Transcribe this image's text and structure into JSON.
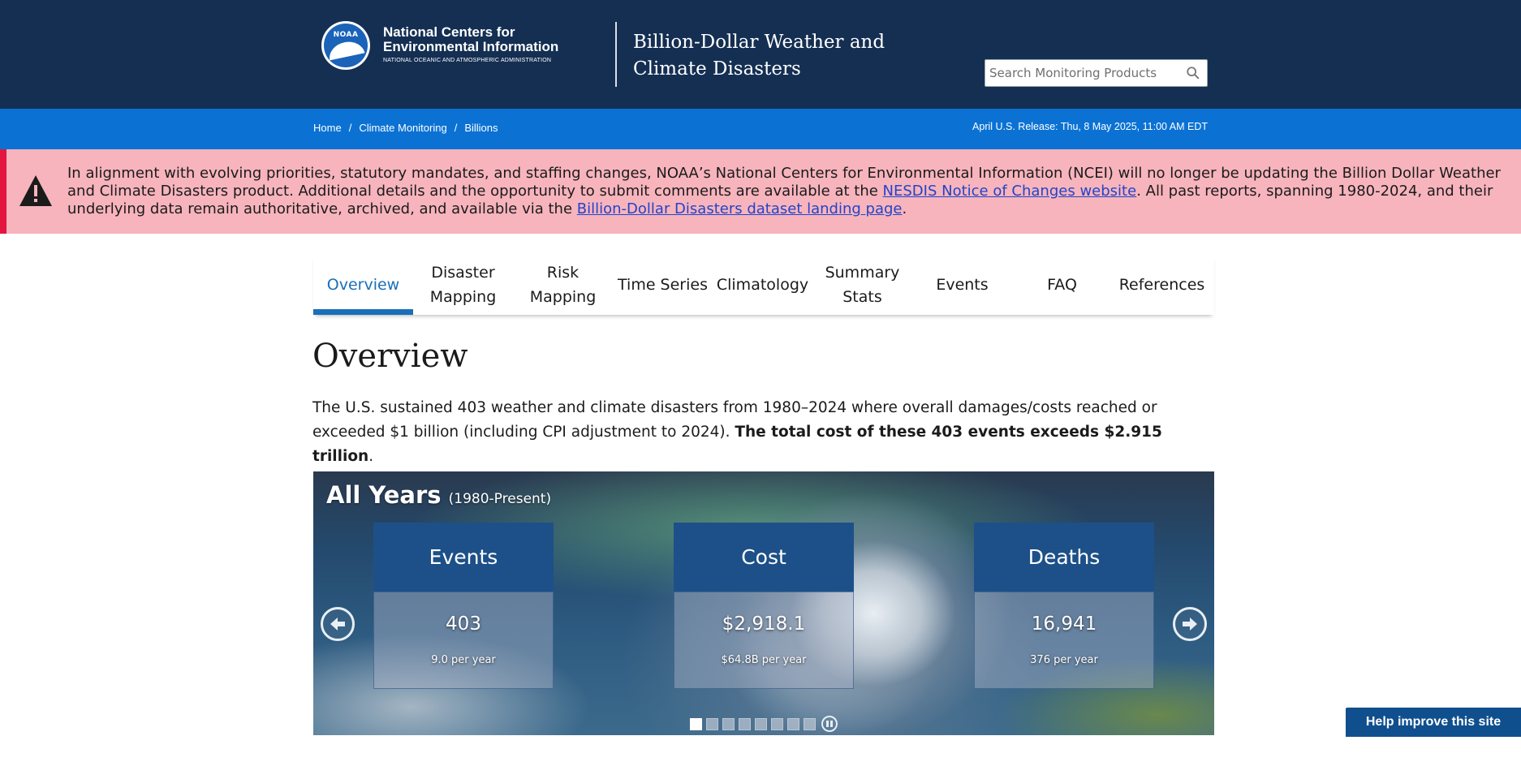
{
  "header": {
    "org_line1": "National Centers for",
    "org_line2": "Environmental Information",
    "org_line3": "NATIONAL OCEANIC AND ATMOSPHERIC ADMINISTRATION",
    "logo_text": "NOAA",
    "site_title": "Billion-Dollar Weather and Climate Disasters",
    "search_placeholder": "Search Monitoring Products"
  },
  "breadcrumb": {
    "items": [
      "Home",
      "Climate Monitoring",
      "Billions"
    ],
    "separator": "/"
  },
  "release_text": "April U.S. Release: Thu, 8 May 2025, 11:00 AM EDT",
  "alert": {
    "text_before": "In alignment with evolving priorities, statutory mandates, and staffing changes, NOAA’s National Centers for Environmental Information (NCEI) will no longer be updating the Billion Dollar Weather and Climate Disasters product. Additional details and the opportunity to submit comments are available at the ",
    "link1": "NESDIS Notice of Changes website",
    "text_middle": ". All past reports, spanning 1980-2024, and their underlying data remain authoritative, archived, and available via the ",
    "link2": "Billion-Dollar Disasters dataset landing page",
    "text_after": "."
  },
  "tabs": [
    {
      "line1": "Overview",
      "line2": ""
    },
    {
      "line1": "Disaster",
      "line2": "Mapping"
    },
    {
      "line1": "Risk",
      "line2": "Mapping"
    },
    {
      "line1": "Time Series",
      "line2": ""
    },
    {
      "line1": "Climatology",
      "line2": ""
    },
    {
      "line1": "Summary",
      "line2": "Stats"
    },
    {
      "line1": "Events",
      "line2": ""
    },
    {
      "line1": "FAQ",
      "line2": ""
    },
    {
      "line1": "References",
      "line2": ""
    }
  ],
  "overview": {
    "title": "Overview",
    "intro_plain": "The U.S. sustained 403 weather and climate disasters from 1980–2024 where overall damages/costs reached or exceeded $1 billion (including CPI adjustment to 2024). ",
    "intro_bold": "The total cost of these 403 events exceeds $2.915 trillion",
    "intro_end": "."
  },
  "carousel": {
    "title": "All Years",
    "subtitle": "(1980-Present)",
    "cards": [
      {
        "label": "Events",
        "value": "403",
        "sub": "9.0 per year"
      },
      {
        "label": "Cost",
        "value": "$2,918.1",
        "sub": "$64.8B per year"
      },
      {
        "label": "Deaths",
        "value": "16,941",
        "sub": "376 per year"
      }
    ],
    "slide_count": 8,
    "active_slide": 0
  },
  "help_button": "Help improve this site",
  "colors": {
    "header_bg": "#142f52",
    "bluebar_bg": "#0b72d4",
    "alert_bg": "#f7b4bd",
    "alert_stripe": "#e3163f",
    "tab_active": "#1a6fb8",
    "card_head": "#1d5088",
    "help_bg": "#0f4f8e"
  }
}
